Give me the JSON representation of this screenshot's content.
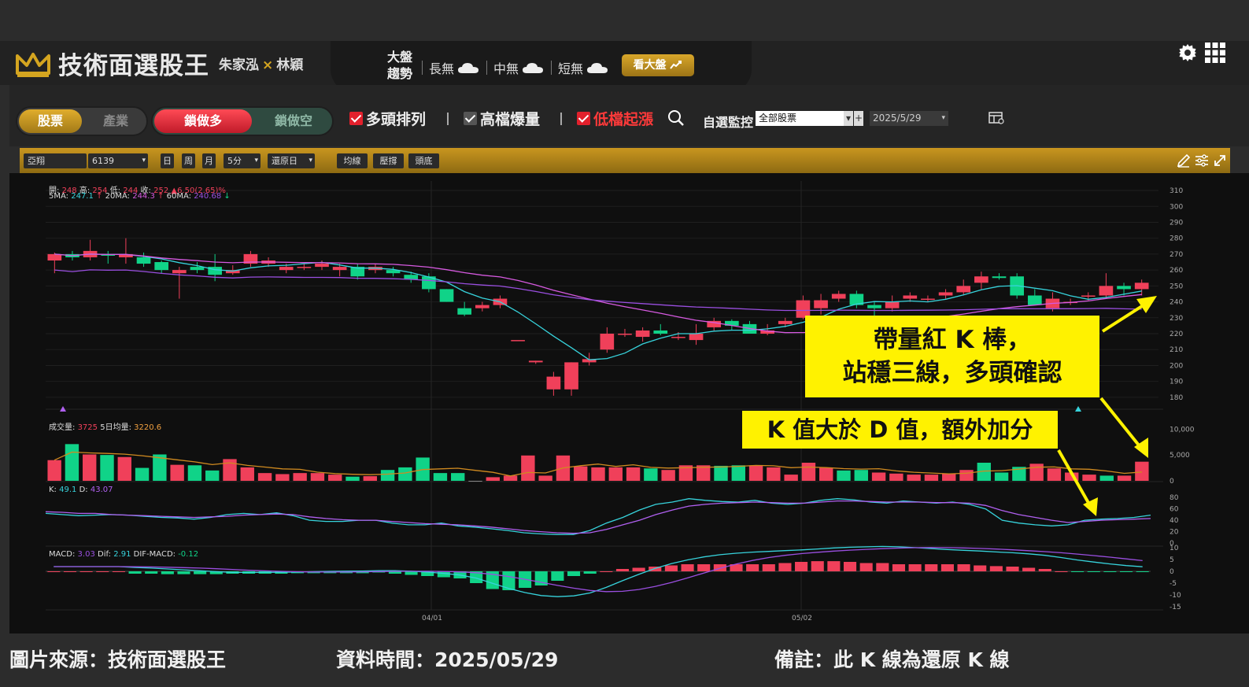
{
  "header": {
    "title": "技術面選股王",
    "host_1": "朱家泓",
    "host_sep": "×",
    "host_2": "林穎",
    "market_label_1": "大盤",
    "market_label_2": "趨勢",
    "market_long": "長無",
    "market_mid": "中無",
    "market_short": "短無",
    "market_button": "看大盤"
  },
  "filters": {
    "tab_stock": "股票",
    "tab_industry": "產業",
    "lock_long": "鎖做多",
    "lock_short": "鎖做空",
    "check_1": "多頭排列",
    "check_2": "高檔爆量",
    "check_3": "低檔起漲",
    "watch_label": "自選監控",
    "watch_value": "全部股票",
    "watch_plus": "+",
    "date_value": "2025/5/29"
  },
  "chart_toolbar": {
    "stock_name": "亞翔",
    "stock_code": "6139",
    "period_day": "日",
    "period_week": "周",
    "period_month": "月",
    "interval": "5分",
    "restore": "還原日",
    "btn_ma": "均線",
    "btn_pressure": "壓撐",
    "btn_top_bottom": "頭底"
  },
  "info": {
    "ohlc_open_label": "開:",
    "ohlc_open": "248",
    "ohlc_high_label": "高:",
    "ohlc_high": "254",
    "ohlc_low_label": "低:",
    "ohlc_low": "244",
    "ohlc_close_label": "收:",
    "ohlc_close": "252",
    "ohlc_change": "▲6.50(2.65)%",
    "ma5_label": "5MA:",
    "ma5": "247.1",
    "ma5_arrow": "↑",
    "ma20_label": "20MA:",
    "ma20": "244.3",
    "ma20_arrow": "↑",
    "ma60_label": "60MA:",
    "ma60": "240.68",
    "ma60_arrow": "↓",
    "vol_label": "成交量:",
    "vol": "3725",
    "vol5_label": "5日均量:",
    "vol5": "3220.6",
    "k_label": "K:",
    "k": "49.1",
    "d_label": "D:",
    "d": "43.07",
    "macd_label": "MACD:",
    "macd": "3.03",
    "dif_label": "Dif:",
    "dif": "2.91",
    "difmacd_label": "DIF-MACD:",
    "difmacd": "-0.12"
  },
  "axes": {
    "price_ticks": [
      "310",
      "300",
      "290",
      "280",
      "270",
      "260",
      "250",
      "240",
      "230",
      "220",
      "210",
      "200",
      "190",
      "180"
    ],
    "volume_ticks": [
      "10,000",
      "5,000",
      "0"
    ],
    "kd_ticks": [
      "80",
      "60",
      "40",
      "20",
      "0"
    ],
    "macd_ticks": [
      "10",
      "5",
      "0",
      "-5",
      "-10",
      "-15"
    ],
    "date_ticks": [
      "04/01",
      "05/02"
    ]
  },
  "callouts": {
    "c1_line1": "帶量紅 K 棒，",
    "c1_line2": "站穩三線，多頭確認",
    "c2": "K 值大於 D 值，額外加分"
  },
  "footer": {
    "source": "圖片來源：技術面選股王",
    "data_time": "資料時間：2025/05/29",
    "note": "備註：此 K 線為還原 K 線"
  },
  "colors": {
    "up": "#f0405a",
    "down": "#10d388",
    "gold": "#d4a520",
    "ma5": "#37d3dc",
    "ma20": "#d65ae0",
    "ma60": "#9a4fe0",
    "callout": "#fff200"
  },
  "chart_data": {
    "type": "candlestick",
    "ylim": [
      175,
      312
    ],
    "candles": [
      [
        266,
        270,
        258,
        271
      ],
      [
        270,
        268,
        266,
        272
      ],
      [
        268,
        272,
        266,
        279
      ],
      [
        270,
        269,
        264,
        272
      ],
      [
        268,
        270,
        264,
        280
      ],
      [
        268,
        264,
        262,
        271
      ],
      [
        265,
        260,
        258,
        266
      ],
      [
        258,
        260,
        242,
        262
      ],
      [
        262,
        260,
        258,
        265
      ],
      [
        262,
        257,
        253,
        270
      ],
      [
        258,
        260,
        257,
        263
      ],
      [
        264,
        270,
        262,
        272
      ],
      [
        264,
        266,
        262,
        268
      ],
      [
        260,
        262,
        258,
        264
      ],
      [
        262,
        262,
        260,
        264
      ],
      [
        262,
        264,
        260,
        266
      ],
      [
        260,
        262,
        256,
        264
      ],
      [
        262,
        256,
        254,
        264
      ],
      [
        260,
        262,
        258,
        264
      ],
      [
        260,
        258,
        256,
        262
      ],
      [
        257,
        254,
        252,
        259
      ],
      [
        256,
        248,
        246,
        258
      ],
      [
        248,
        240,
        240,
        248
      ],
      [
        236,
        232,
        231,
        240
      ],
      [
        236,
        238,
        234,
        240
      ],
      [
        238,
        242,
        236,
        244
      ],
      [
        216,
        216,
        216,
        216
      ],
      [
        202,
        203,
        201,
        203
      ],
      [
        185,
        193,
        181,
        196
      ],
      [
        185,
        202,
        181,
        202
      ],
      [
        202,
        204,
        200,
        208
      ],
      [
        210,
        220,
        208,
        224
      ],
      [
        220,
        220,
        218,
        223
      ],
      [
        218,
        222,
        215,
        224
      ],
      [
        222,
        220,
        219,
        226
      ],
      [
        218,
        218,
        216,
        221
      ],
      [
        216,
        220,
        213,
        226
      ],
      [
        224,
        228,
        222,
        230
      ],
      [
        228,
        225,
        222,
        229
      ],
      [
        226,
        220,
        220,
        228
      ],
      [
        220,
        222,
        219,
        226
      ],
      [
        226,
        228,
        224,
        230
      ],
      [
        230,
        241,
        229,
        244
      ],
      [
        236,
        241,
        232,
        245
      ],
      [
        242,
        245,
        240,
        247
      ],
      [
        245,
        238,
        236,
        247
      ],
      [
        238,
        236,
        230,
        240
      ],
      [
        236,
        240,
        234,
        244
      ],
      [
        242,
        244,
        240,
        246
      ],
      [
        242,
        242,
        240,
        244
      ],
      [
        244,
        246,
        242,
        248
      ],
      [
        246,
        250,
        244,
        254
      ],
      [
        252,
        256,
        248,
        259
      ],
      [
        256,
        255,
        254,
        258
      ],
      [
        256,
        244,
        242,
        258
      ],
      [
        244,
        238,
        238,
        248
      ],
      [
        236,
        242,
        234,
        246
      ],
      [
        240,
        240,
        238,
        242
      ],
      [
        244,
        244,
        241,
        246
      ],
      [
        244,
        250,
        242,
        258
      ],
      [
        250,
        248,
        244,
        252
      ],
      [
        248,
        252,
        244,
        254
      ]
    ],
    "volume": [
      4000,
      7100,
      5100,
      5000,
      4600,
      2500,
      5100,
      3100,
      3000,
      2000,
      4200,
      2600,
      1500,
      1300,
      1500,
      1500,
      1200,
      800,
      900,
      2100,
      2600,
      4500,
      1500,
      1500,
      0,
      700,
      1000,
      4900,
      1000,
      4900,
      2800,
      2600,
      2600,
      2600,
      2400,
      2100,
      3000,
      3000,
      2900,
      3000,
      3000,
      2600,
      1200,
      3500,
      2500,
      2000,
      2100,
      1600,
      1400,
      1200,
      1200,
      1400,
      2100,
      3500,
      1600,
      2700,
      3300,
      2400,
      1600,
      1200,
      1000,
      1000,
      3700
    ],
    "kd_k": [
      52,
      50,
      48,
      49,
      50,
      49,
      47,
      45,
      44,
      42,
      45,
      50,
      52,
      50,
      53,
      48,
      40,
      38,
      38,
      40,
      40,
      35,
      32,
      32,
      35,
      30,
      28,
      25,
      22,
      18,
      16,
      15,
      15,
      22,
      35,
      45,
      58,
      68,
      72,
      78,
      75,
      73,
      72,
      75,
      70,
      68,
      70,
      75,
      78,
      76,
      72,
      70,
      74,
      72,
      70,
      72,
      68,
      60,
      40,
      35,
      32,
      30,
      32,
      40,
      42,
      43,
      45,
      49
    ],
    "kd_d": [
      55,
      54,
      52,
      52,
      50,
      49,
      48,
      47,
      46,
      45,
      46,
      47,
      49,
      50,
      51,
      50,
      46,
      43,
      41,
      40,
      40,
      38,
      36,
      34,
      33,
      32,
      30,
      28,
      25,
      22,
      20,
      18,
      17,
      18,
      24,
      32,
      40,
      50,
      58,
      65,
      68,
      70,
      71,
      72,
      71,
      70,
      70,
      72,
      74,
      74,
      73,
      72,
      72,
      72,
      71,
      71,
      70,
      66,
      57,
      50,
      45,
      40,
      36,
      38,
      40,
      41,
      42,
      43
    ],
    "macd_hist": [
      0,
      0,
      0,
      0,
      0,
      -1,
      -1,
      -1.2,
      -1.2,
      -1.2,
      -1.2,
      -1,
      -1,
      -1,
      -1,
      -0.8,
      -0.8,
      -0.8,
      -0.8,
      -0.8,
      -0.5,
      -1,
      -1.5,
      -2,
      -2.5,
      -3,
      -5,
      -7.5,
      -8,
      -7,
      -6,
      -4,
      -2,
      -1,
      0,
      1,
      1.5,
      2,
      2.5,
      3,
      3,
      3,
      3,
      3,
      3,
      3.5,
      4,
      4.3,
      4.3,
      4,
      3.5,
      3.5,
      3,
      3,
      3,
      3,
      3,
      2.5,
      2.2,
      2,
      1.5,
      1,
      0,
      -0.3,
      -0.3,
      -0.3,
      -0.2,
      -0.12
    ]
  }
}
